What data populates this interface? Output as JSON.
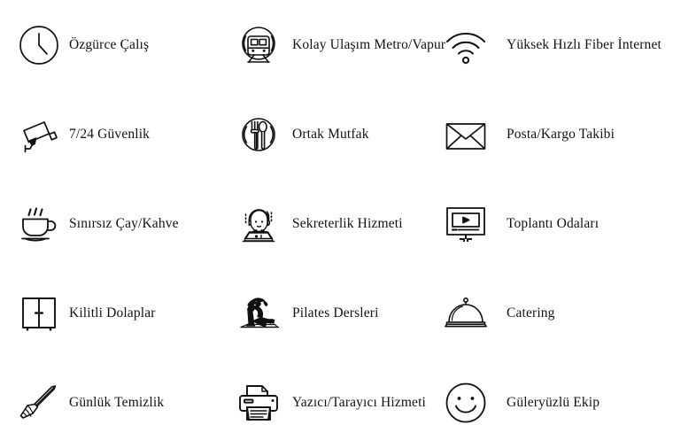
{
  "page": {
    "background_color": "#ffffff",
    "text_color": "#121212",
    "stroke_color": "#111111",
    "columns": 3,
    "rows": 5
  },
  "features": [
    {
      "icon": "clock-icon",
      "label": "Özgürce Çalış"
    },
    {
      "icon": "metro-train-icon",
      "label": "Kolay Ulaşım Metro/Vapur"
    },
    {
      "icon": "wifi-icon",
      "label": "Yüksek Hızlı Fiber İnternet"
    },
    {
      "icon": "security-camera-icon",
      "label": "7/24 Güvenlik"
    },
    {
      "icon": "cutlery-circle-icon",
      "label": "Ortak Mutfak"
    },
    {
      "icon": "envelope-icon",
      "label": "Posta/Kargo Takibi"
    },
    {
      "icon": "coffee-cup-icon",
      "label": "Sınırsız Çay/Kahve"
    },
    {
      "icon": "headset-operator-icon",
      "label": "Sekreterlik Hizmeti"
    },
    {
      "icon": "monitor-play-icon",
      "label": "Toplantı Odaları"
    },
    {
      "icon": "locker-cabinet-icon",
      "label": "Kilitli Dolaplar"
    },
    {
      "icon": "yoga-pose-icon",
      "label": "Pilates Dersleri"
    },
    {
      "icon": "cloche-dome-icon",
      "label": "Catering"
    },
    {
      "icon": "broom-icon",
      "label": "Günlük Temizlik"
    },
    {
      "icon": "printer-icon",
      "label": "Yazıcı/Tarayıcı Hizmeti"
    },
    {
      "icon": "smiley-face-icon",
      "label": "Güleryüzlü Ekip"
    }
  ]
}
